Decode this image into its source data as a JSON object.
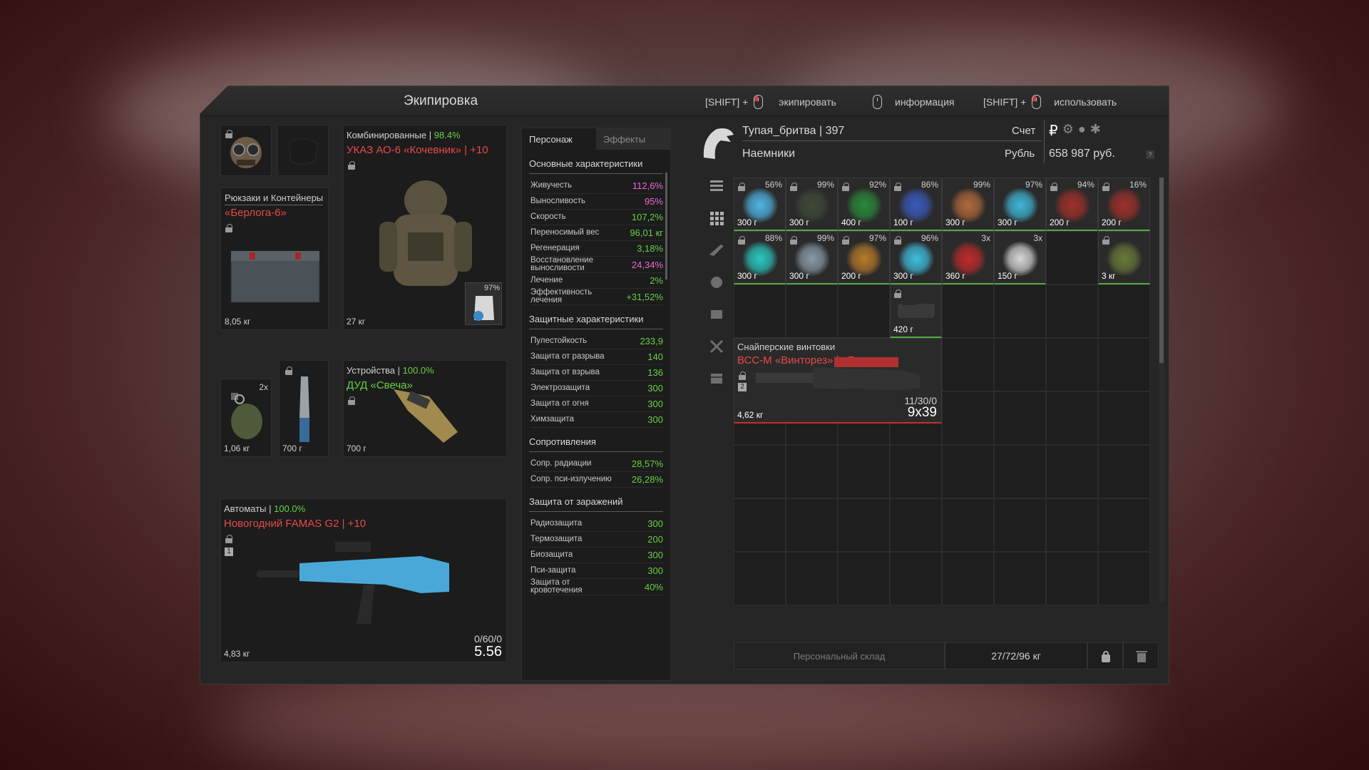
{
  "window_title": "Экипировка",
  "hints": [
    {
      "prefix": "[SHIFT] +",
      "label": "экипировать"
    },
    {
      "prefix": "",
      "label": "информация"
    },
    {
      "prefix": "[SHIFT] +",
      "label": "использовать"
    }
  ],
  "equipment": {
    "backpack": {
      "category": "Рюкзаки и Контейнеры",
      "name": "«Берлога-6»",
      "weight": "8,05 кг"
    },
    "armor": {
      "category": "Комбинированные",
      "durability": "98.4%",
      "name": "УКАЗ АО-6 «Кочевник» | +10",
      "weight": "27 кг",
      "plate_pct": "97%"
    },
    "devices": {
      "category": "Устройства",
      "durability": "100.0%",
      "name": "ДУД «Свеча»",
      "weight": "700 г"
    },
    "grenade": {
      "count": "2x",
      "weight": "1,06 кг"
    },
    "knife": {
      "weight": "700 г"
    },
    "weapon": {
      "category": "Автоматы",
      "durability": "100.0%",
      "name": "Новогодний FAMAS G2 | +10",
      "weight": "4,83 кг",
      "ammo": "0/60/0",
      "caliber": "5.56",
      "slot_num": "1"
    }
  },
  "stats_tabs": {
    "active": "Персонаж",
    "inactive": "Эффекты"
  },
  "stats": {
    "basic": {
      "header": "Основные характеристики",
      "rows": [
        {
          "label": "Живучесть",
          "value": "112,6%",
          "color": "pink"
        },
        {
          "label": "Выносливость",
          "value": "95%",
          "color": "pink"
        },
        {
          "label": "Скорость",
          "value": "107,2%",
          "color": "green"
        },
        {
          "label": "Переносимый вес",
          "value": "96,01 кг",
          "color": "green"
        },
        {
          "label": "Регенерация",
          "value": "3,18%",
          "color": "green"
        },
        {
          "label": "Восстановление выносливости",
          "value": "24,34%",
          "color": "pink"
        },
        {
          "label": "Лечение",
          "value": "2%",
          "color": "green"
        },
        {
          "label": "Эффективность лечения",
          "value": "+31,52%",
          "color": "green"
        }
      ]
    },
    "protection": {
      "header": "Защитные характеристики",
      "rows": [
        {
          "label": "Пулестойкость",
          "value": "233,9",
          "color": "green"
        },
        {
          "label": "Защита от разрыва",
          "value": "140",
          "color": "green"
        },
        {
          "label": "Защита от взрыва",
          "value": "136",
          "color": "green"
        },
        {
          "label": "Электрозащита",
          "value": "300",
          "color": "green"
        },
        {
          "label": "Защита от огня",
          "value": "300",
          "color": "green"
        },
        {
          "label": "Химзащита",
          "value": "300",
          "color": "green"
        }
      ]
    },
    "resist": {
      "header": "Сопротивления",
      "rows": [
        {
          "label": "Сопр. радиации",
          "value": "28,57%",
          "color": "green"
        },
        {
          "label": "Сопр. пси-излучению",
          "value": "26,28%",
          "color": "green"
        }
      ]
    },
    "contamination": {
      "header": "Защита от заражений",
      "rows": [
        {
          "label": "Радиозащита",
          "value": "300",
          "color": "green"
        },
        {
          "label": "Термозащита",
          "value": "200",
          "color": "green"
        },
        {
          "label": "Биозащита",
          "value": "300",
          "color": "green"
        },
        {
          "label": "Пси-защита",
          "value": "300",
          "color": "green"
        },
        {
          "label": "Защита от кровотечения",
          "value": "40%",
          "color": "green"
        }
      ]
    }
  },
  "player": {
    "name": "Тупая_бритва | 397",
    "faction": "Наемники",
    "account_label": "Счет",
    "currency_label": "Рубль",
    "money": "658 987 руб."
  },
  "inventory": {
    "row1": [
      {
        "pct": "56%",
        "weight": "300 г",
        "art": "#4fb6e6"
      },
      {
        "pct": "99%",
        "weight": "300 г",
        "art": "#3f4a38"
      },
      {
        "pct": "92%",
        "weight": "400 г",
        "art": "#2a8a3a"
      },
      {
        "pct": "86%",
        "weight": "100 г",
        "art": "#3a5abf"
      },
      {
        "pct": "99%",
        "weight": "300 г",
        "art": "#b06a3a"
      },
      {
        "pct": "97%",
        "weight": "300 г",
        "art": "#3fb8d8"
      },
      {
        "pct": "94%",
        "weight": "200 г",
        "art": "#a0302a"
      },
      {
        "pct": "16%",
        "weight": "200 г",
        "art": "#a0302a"
      }
    ],
    "row2": [
      {
        "pct": "88%",
        "weight": "300 г",
        "art": "#2ac8c0"
      },
      {
        "pct": "99%",
        "weight": "300 г",
        "art": "#8a9aa8"
      },
      {
        "pct": "97%",
        "weight": "200 г",
        "art": "#b87a2a"
      },
      {
        "pct": "96%",
        "weight": "300 г",
        "art": "#3fc0e0"
      },
      {
        "pct": "3x",
        "weight": "360 г",
        "art": "#c02a2a"
      },
      {
        "pct": "3x",
        "weight": "150 г",
        "art": "#d8d8d8"
      },
      {
        "pct": "",
        "weight": "3 кг",
        "art": "#6a7a3a"
      }
    ],
    "row3_item": {
      "weight": "420 г"
    },
    "sniper": {
      "category": "Снайперские винтовки",
      "name": "ВСС-М «Винторез» | +7",
      "weight": "4,62 кг",
      "ammo": "11/30/0",
      "caliber": "9x39",
      "slot_num": "2"
    }
  },
  "footer": {
    "storage": "Персональный склад",
    "weight": "27/72/96 кг"
  }
}
